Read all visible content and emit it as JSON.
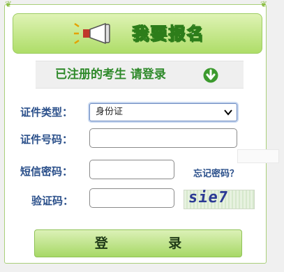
{
  "header": {
    "title": "我要报名",
    "icon": "megaphone-icon"
  },
  "login_prompt": {
    "text": "已注册的考生 请登录",
    "icon": "arrow-down-circle-icon"
  },
  "form": {
    "id_type": {
      "label": "证件类型：",
      "selected": "身份证"
    },
    "id_number": {
      "label": "证件号码：",
      "value": "",
      "placeholder": ""
    },
    "sms_code": {
      "label": "短信密码：",
      "value": ""
    },
    "forgot_password": "忘记密码？",
    "captcha": {
      "label": "验证码：",
      "value": "",
      "image_text": "sie7"
    }
  },
  "login_button": "登    录",
  "colors": {
    "brand_green": "#2f8a2b",
    "label_blue": "#2a4f8a",
    "button_green": "#a7d866"
  }
}
